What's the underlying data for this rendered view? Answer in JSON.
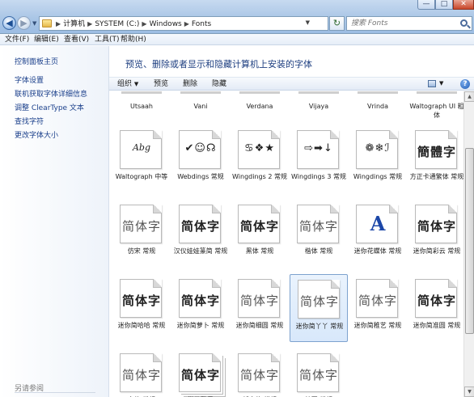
{
  "window": {
    "min_glyph": "—",
    "max_glyph": "□",
    "close_glyph": "✕"
  },
  "nav": {
    "back_glyph": "◀",
    "forward_glyph": "▶",
    "dropdown_glyph": "▼",
    "refresh_glyph": "↻"
  },
  "address": {
    "crumbs": [
      "计算机",
      "SYSTEM (C:)",
      "Windows",
      "Fonts"
    ],
    "separator": "▶"
  },
  "search": {
    "placeholder": "搜索 Fonts"
  },
  "menu": {
    "file": "文件(F)",
    "edit": "编辑(E)",
    "view": "查看(V)",
    "tools": "工具(T)",
    "help": "帮助(H)"
  },
  "sidebar": {
    "links": [
      "控制面板主页",
      "字体设置",
      "联机获取字体详细信息",
      "调整 ClearType 文本",
      "查找字符",
      "更改字体大小"
    ],
    "see_also": "另请参阅"
  },
  "main": {
    "heading": "预览、删除或者显示和隐藏计算机上安装的字体"
  },
  "toolbar": {
    "organize": "组织",
    "organize_glyph": "▼",
    "preview": "预览",
    "delete": "删除",
    "hide": "隐藏",
    "views_glyph": "▼",
    "help_glyph": "?"
  },
  "partial_row": [
    "Utsaah",
    "Vani",
    "Verdana",
    "Vijaya",
    "Vrinda",
    "Waltograph UI 粗体"
  ],
  "fonts": [
    {
      "sample": "Abg",
      "kind": "latin",
      "label": "Waltograph 中等"
    },
    {
      "sample": "✔☺☊",
      "kind": "sym",
      "label": "Webdings 常规"
    },
    {
      "sample": "♋❖★",
      "kind": "sym",
      "label": "Wingdings 2 常规"
    },
    {
      "sample": "⇨➡↓",
      "kind": "sym",
      "label": "Wingdings 3 常规"
    },
    {
      "sample": "❁❄ℐ",
      "kind": "sym",
      "label": "Wingdings 常规"
    },
    {
      "sample": "簡體字",
      "kind": "cjk bold",
      "label": "方正卡通繁体 常规"
    },
    {
      "sample": "简体字",
      "kind": "cjk light",
      "label": "仿宋 常规"
    },
    {
      "sample": "简体字",
      "kind": "cjk bold",
      "label": "汉仪娃娃篆简 常规"
    },
    {
      "sample": "简体字",
      "kind": "cjk bold",
      "label": "黑体 常规"
    },
    {
      "sample": "简体字",
      "kind": "cjk light",
      "label": "楷体 常规"
    },
    {
      "sample": "A",
      "kind": "big-a",
      "label": "迷你花蝶体 常规"
    },
    {
      "sample": "简体字",
      "kind": "cjk bold",
      "label": "迷你简彩云 常规"
    },
    {
      "sample": "简体字",
      "kind": "cjk bold",
      "label": "迷你简哈哈 常规"
    },
    {
      "sample": "简体字",
      "kind": "cjk bold",
      "label": "迷你简萝卜 常规"
    },
    {
      "sample": "简体字",
      "kind": "cjk light",
      "label": "迷你简细圆 常规"
    },
    {
      "sample": "简体字",
      "kind": "cjk light",
      "label": "迷你简丫丫 常规"
    },
    {
      "sample": "简体字",
      "kind": "cjk light",
      "label": "迷你简稚艺 常规"
    },
    {
      "sample": "简体字",
      "kind": "cjk bold",
      "label": "迷你简准圆 常规"
    },
    {
      "sample": "简体字",
      "kind": "cjk light",
      "label": "宋体 常规"
    },
    {
      "sample": "简体字",
      "kind": "cjk bold stack",
      "label": "微软雅黑"
    },
    {
      "sample": "简体字",
      "kind": "cjk light",
      "label": "新宋体 常规"
    },
    {
      "sample": "简体字",
      "kind": "cjk light",
      "label": "幼圆 常规"
    }
  ],
  "selected_index": 15,
  "scroll": {
    "up_glyph": "▲",
    "down_glyph": "▼"
  }
}
